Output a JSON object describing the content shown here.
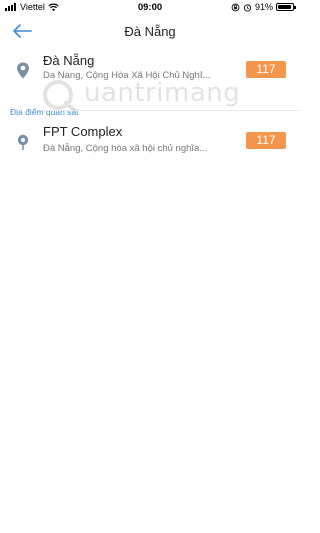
{
  "status_bar": {
    "carrier": "Viettel",
    "time": "09:00",
    "battery": "91%",
    "battery_level": 0.91
  },
  "header": {
    "title": "Đà Nẵng",
    "back_icon": "arrow-left-icon"
  },
  "list": [
    {
      "name": "Đà Nẵng",
      "address": "Da Nang, Cộng Hòa Xã Hội Chủ Nghĩ...",
      "aqi": "117",
      "section_label": "Địa điểm quan sát",
      "icon": "map-pin-icon"
    },
    {
      "name": "FPT Complex",
      "address": "Đà Nẵng, Cộng hòa xã hội chủ nghĩa...",
      "aqi": "117",
      "icon": "station-icon"
    }
  ],
  "colors": {
    "badge": "#f5964d",
    "section_label": "#3a8ed6",
    "back_arrow": "#3a8ed6"
  },
  "watermark": "uantrimang"
}
